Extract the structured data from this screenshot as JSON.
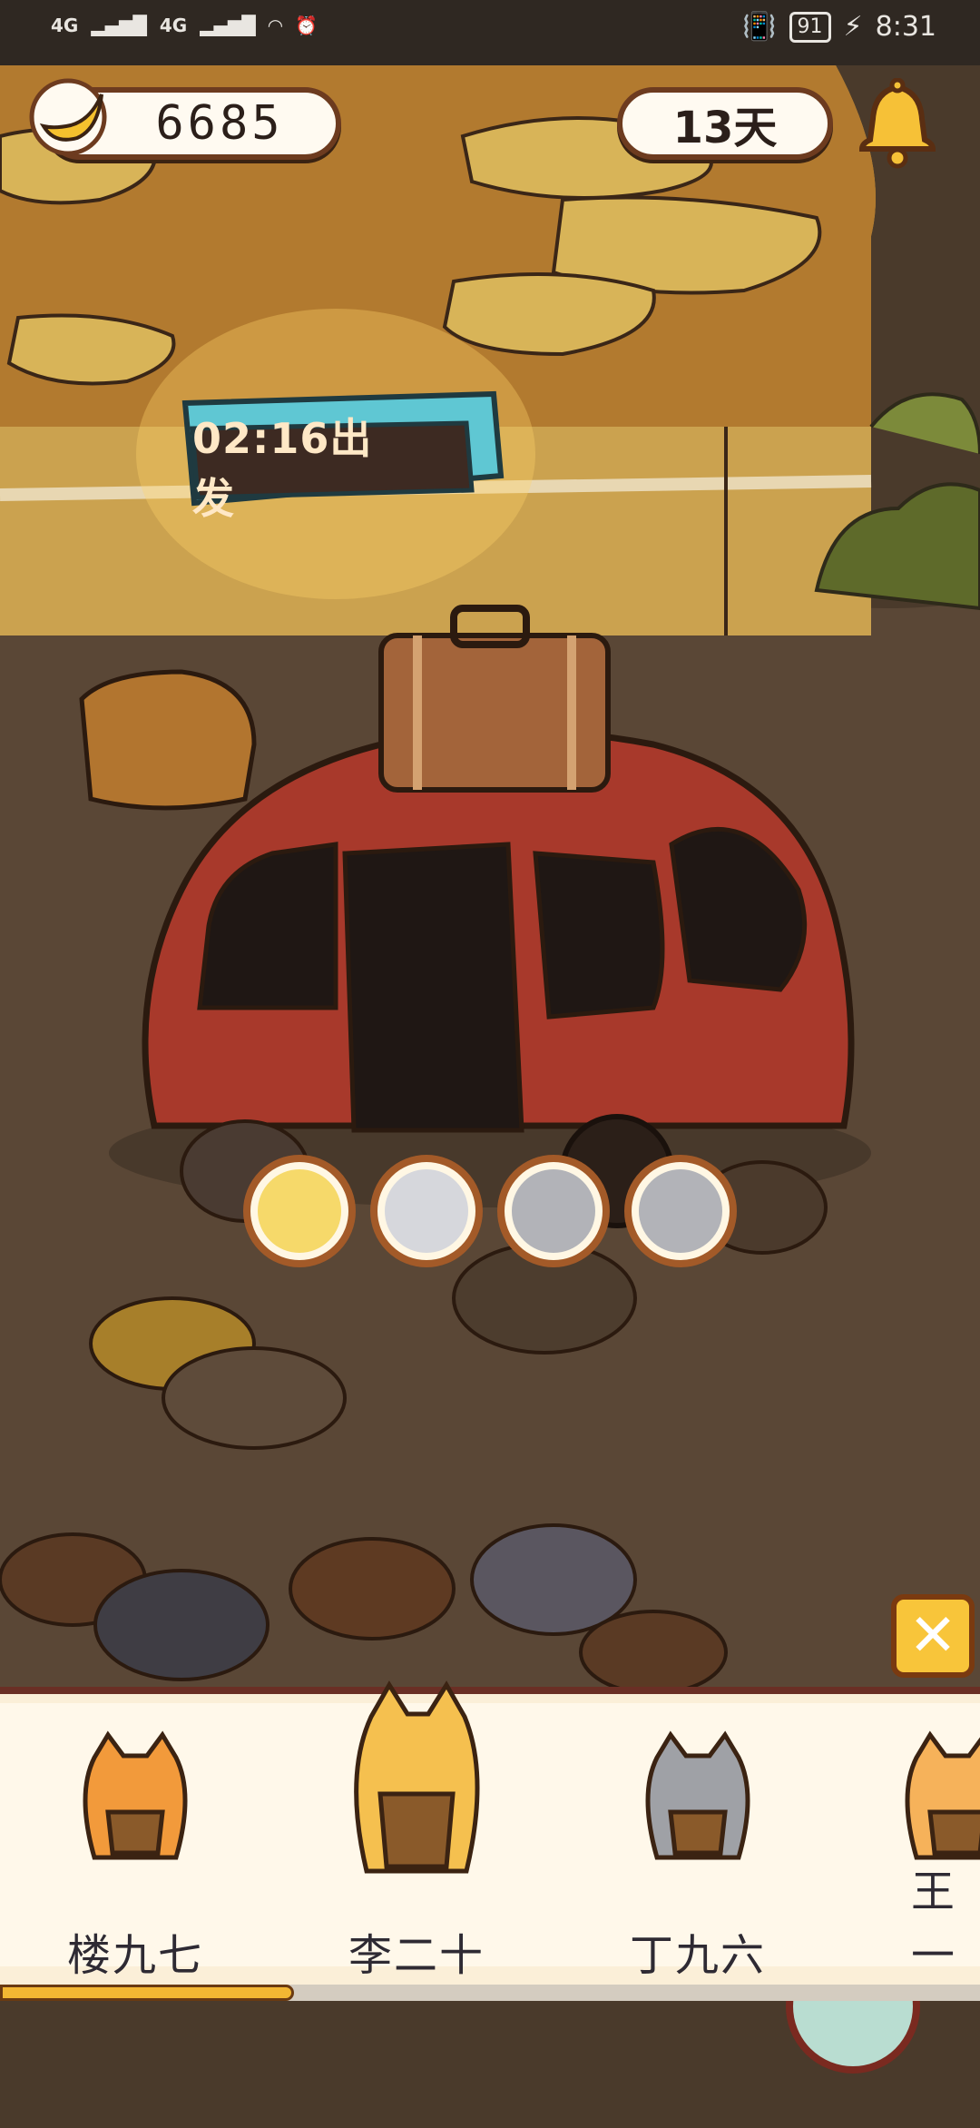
{
  "status_bar": {
    "network_left_1": "4G",
    "network_left_2": "4G",
    "battery": "91",
    "time": "8:31"
  },
  "hud": {
    "coins": "6685",
    "days": "13天"
  },
  "departure": {
    "timer_text": "02:16出发"
  },
  "cats": [
    {
      "name": "楼九七",
      "color": "#f29a3b"
    },
    {
      "name": "李二十",
      "color": "#f5c04f"
    },
    {
      "name": "丁九六",
      "color": "#9fa1a6"
    },
    {
      "name": "王一",
      "color": "#f6b25a"
    }
  ],
  "selector": {
    "close_label": "✕",
    "progress": 0.3
  },
  "colors": {
    "accent": "#f3b733",
    "brown_border": "#6d3b1f",
    "car": "#a8392b"
  }
}
